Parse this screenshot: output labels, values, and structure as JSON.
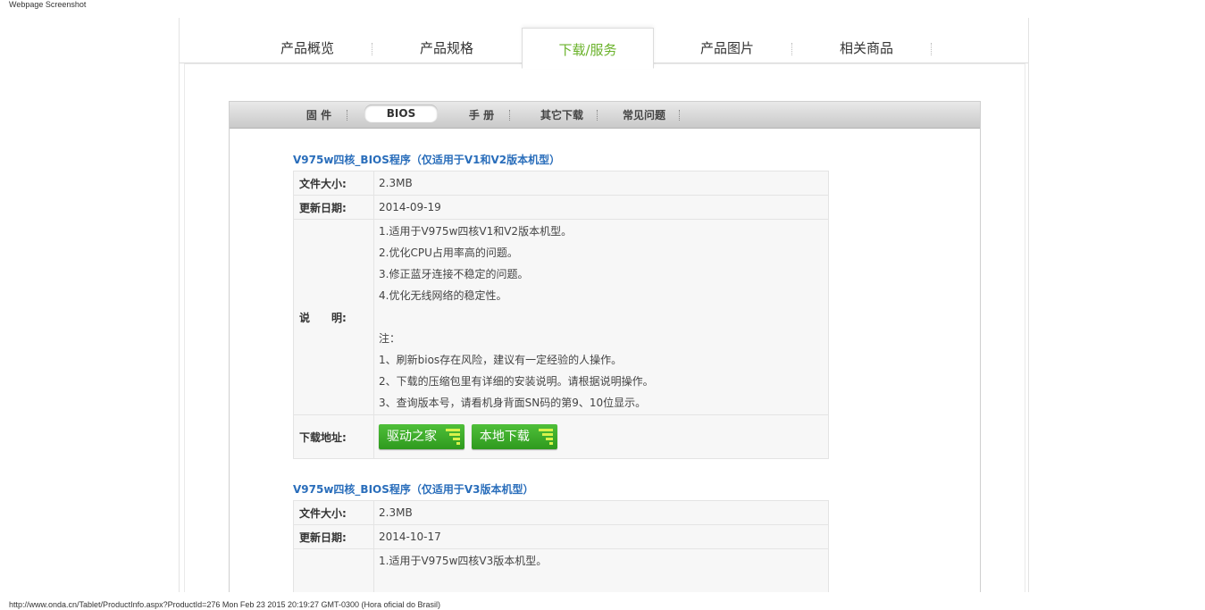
{
  "captions": {
    "top": "Webpage Screenshot",
    "bottom": "http://www.onda.cn/Tablet/ProductInfo.aspx?ProductId=276 Mon Feb 23 2015 20:19:27 GMT-0300 (Hora oficial do Brasil)"
  },
  "main_tabs": [
    "产品概览",
    "产品规格",
    "下载/服务",
    "产品图片",
    "相关商品"
  ],
  "main_tab_active": "下载/服务",
  "sub_tabs": [
    "固 件",
    "BIOS",
    "手 册",
    "其它下载",
    "常见问题"
  ],
  "sub_tab_active": "BIOS",
  "colors": {
    "link_blue": "#2a6ebb",
    "active_green": "#6ab22a",
    "button_green": "#3aaa28"
  },
  "sections": [
    {
      "title": "V975w四核_BIOS程序（仅适用于V1和V2版本机型）",
      "size_label": "文件大小:",
      "size": "2.3MB",
      "date_label": "更新日期:",
      "date": "2014-09-19",
      "desc_label": "说　　明:",
      "desc_lines": [
        "1.适用于V975w四核V1和V2版本机型。",
        "2.优化CPU占用率高的问题。",
        "3.修正蓝牙连接不稳定的问题。",
        "4.优化无线网络的稳定性。",
        "",
        "注：",
        "1、刷新bios存在风险，建议有一定经验的人操作。",
        "2、下载的压缩包里有详细的安装说明。请根据说明操作。",
        "3、查询版本号，请看机身背面SN码的第9、10位显示。"
      ],
      "download_label": "下载地址:",
      "buttons": [
        "驱动之家",
        "本地下载"
      ]
    },
    {
      "title": "V975w四核_BIOS程序（仅适用于V3版本机型）",
      "size_label": "文件大小:",
      "size": "2.3MB",
      "date_label": "更新日期:",
      "date": "2014-10-17",
      "desc_lines": [
        "1.适用于V975w四核V3版本机型。"
      ]
    }
  ]
}
